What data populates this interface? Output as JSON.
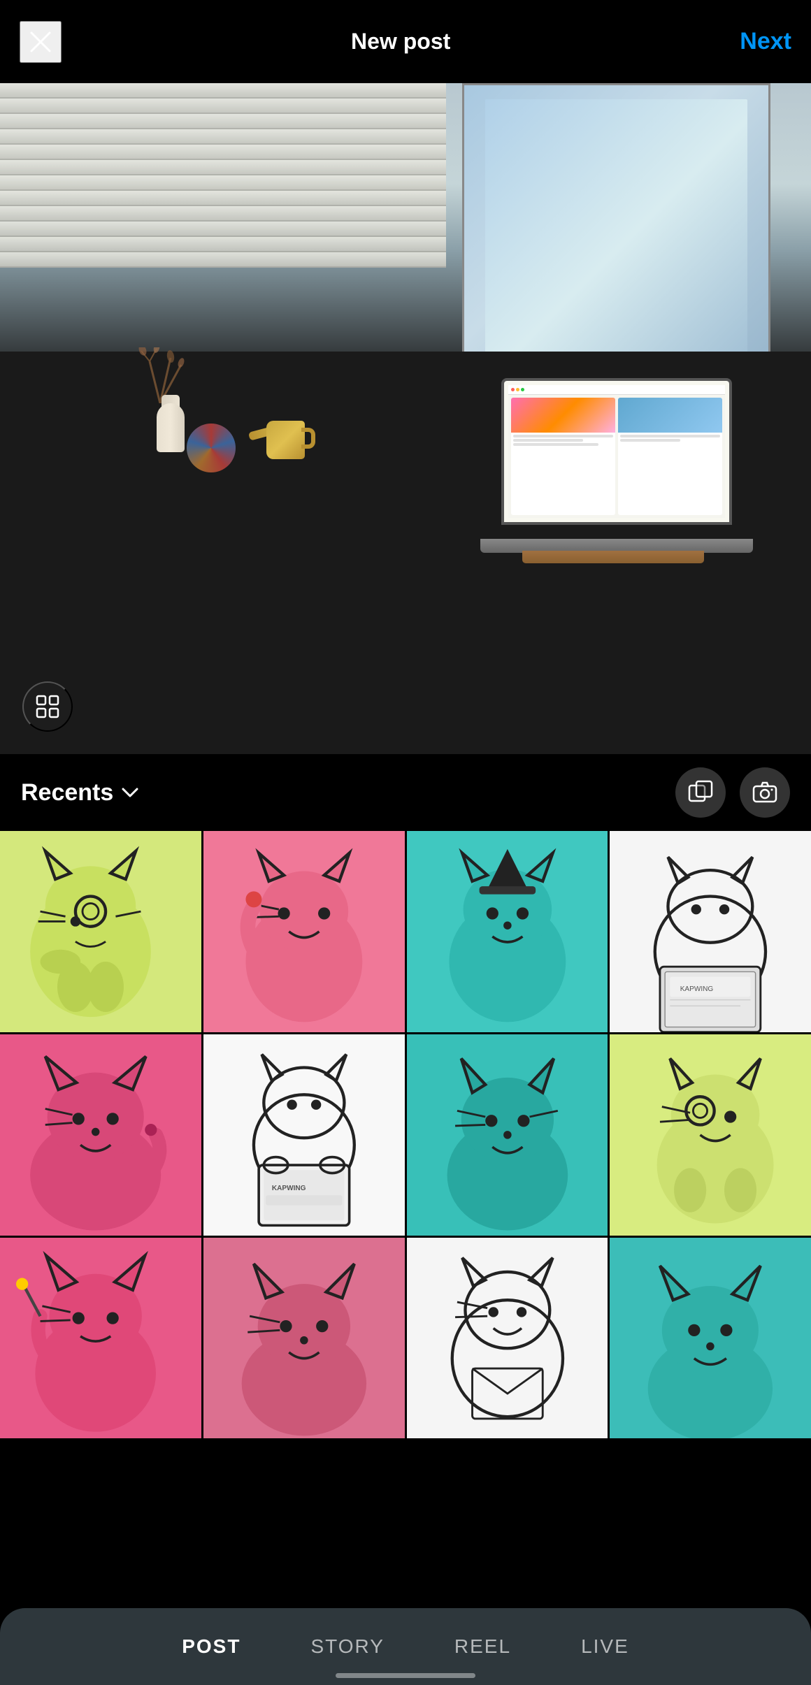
{
  "header": {
    "title": "New post",
    "close_label": "×",
    "next_label": "Next"
  },
  "gallery": {
    "album_label": "Recents",
    "multi_icon": "multi-select-icon",
    "camera_icon": "camera-icon"
  },
  "tabs": [
    {
      "label": "POST",
      "active": true
    },
    {
      "label": "STORY",
      "active": false
    },
    {
      "label": "REEL",
      "active": false
    },
    {
      "label": "LIVE",
      "active": false
    }
  ],
  "photos": [
    {
      "id": 1,
      "style": "cat-yellow-1",
      "alt": "yellow cat"
    },
    {
      "id": 2,
      "style": "cat-pink-1",
      "alt": "pink cat with monocle"
    },
    {
      "id": 3,
      "style": "cat-teal-1",
      "alt": "teal cat with hat"
    },
    {
      "id": 4,
      "style": "cat-outline-laptop",
      "alt": "outline cat with laptop"
    },
    {
      "id": 5,
      "style": "cat-pink-2",
      "alt": "large pink cat"
    },
    {
      "id": 6,
      "style": "cat-outline-laptop2",
      "alt": "outline cat with kapwing laptop"
    },
    {
      "id": 7,
      "style": "cat-teal-2",
      "alt": "teal sitting cat"
    },
    {
      "id": 8,
      "style": "cat-yellow-2",
      "alt": "yellow cat looking"
    },
    {
      "id": 9,
      "style": "cat-pink-3",
      "alt": "pink cat with wand"
    },
    {
      "id": 10,
      "style": "cat-pink-4",
      "alt": "pink cat sitting"
    },
    {
      "id": 11,
      "style": "cat-outline-3",
      "alt": "outline cat"
    },
    {
      "id": 12,
      "style": "cat-teal-3",
      "alt": "teal cat partial"
    }
  ],
  "colors": {
    "accent_blue": "#0095f6",
    "header_bg": "#000000",
    "tab_bar_bg": "rgba(50,60,65,0.92)",
    "active_tab": "#ffffff",
    "inactive_tab": "rgba(255,255,255,0.65)"
  }
}
